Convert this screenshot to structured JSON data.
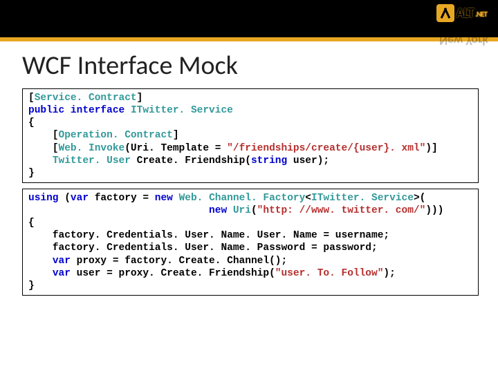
{
  "brand": {
    "name_line1": "ALT",
    "name_line1_suffix": ".NET",
    "name_line2": "New York"
  },
  "slide": {
    "title": "WCF Interface Mock"
  },
  "code_block_1": [
    {
      "indent": 0,
      "tokens": [
        {
          "c": "pln",
          "t": "["
        },
        {
          "c": "typ",
          "t": "Service. Contract"
        },
        {
          "c": "pln",
          "t": "]"
        }
      ]
    },
    {
      "indent": 0,
      "tokens": [
        {
          "c": "kw",
          "t": "public interface "
        },
        {
          "c": "typ",
          "t": "ITwitter. Service"
        }
      ]
    },
    {
      "indent": 0,
      "tokens": [
        {
          "c": "pln",
          "t": "{"
        }
      ]
    },
    {
      "indent": 1,
      "tokens": [
        {
          "c": "pln",
          "t": "["
        },
        {
          "c": "typ",
          "t": "Operation. Contract"
        },
        {
          "c": "pln",
          "t": "]"
        }
      ]
    },
    {
      "indent": 1,
      "tokens": [
        {
          "c": "pln",
          "t": "["
        },
        {
          "c": "typ",
          "t": "Web. Invoke"
        },
        {
          "c": "pln",
          "t": "(Uri. Template = "
        },
        {
          "c": "str",
          "t": "\"/friendships/create/{user}. xml\""
        },
        {
          "c": "pln",
          "t": ")]"
        }
      ]
    },
    {
      "indent": 1,
      "tokens": [
        {
          "c": "typ",
          "t": "Twitter. User"
        },
        {
          "c": "pln",
          "t": " Create. Friendship("
        },
        {
          "c": "kw",
          "t": "string"
        },
        {
          "c": "pln",
          "t": " user);"
        }
      ]
    },
    {
      "indent": 0,
      "tokens": [
        {
          "c": "pln",
          "t": "}"
        }
      ]
    }
  ],
  "code_block_2": [
    {
      "indent": 0,
      "tokens": [
        {
          "c": "kw",
          "t": "using "
        },
        {
          "c": "pln",
          "t": "("
        },
        {
          "c": "kw",
          "t": "var"
        },
        {
          "c": "pln",
          "t": " factory = "
        },
        {
          "c": "kw",
          "t": "new "
        },
        {
          "c": "typ",
          "t": "Web. Channel. Factory"
        },
        {
          "c": "pln",
          "t": "<"
        },
        {
          "c": "typ",
          "t": "ITwitter. Service"
        },
        {
          "c": "pln",
          "t": ">("
        }
      ]
    },
    {
      "indent": 0,
      "tokens": [
        {
          "c": "pln",
          "t": "                              "
        },
        {
          "c": "kw",
          "t": "new "
        },
        {
          "c": "typ",
          "t": "Uri"
        },
        {
          "c": "pln",
          "t": "("
        },
        {
          "c": "str",
          "t": "\"http: //www. twitter. com/\""
        },
        {
          "c": "pln",
          "t": ")))"
        }
      ]
    },
    {
      "indent": 0,
      "tokens": [
        {
          "c": "pln",
          "t": "{"
        }
      ]
    },
    {
      "indent": 1,
      "tokens": [
        {
          "c": "pln",
          "t": "factory. Credentials. User. Name. User. Name = username;"
        }
      ]
    },
    {
      "indent": 1,
      "tokens": [
        {
          "c": "pln",
          "t": "factory. Credentials. User. Name. Password = password;"
        }
      ]
    },
    {
      "indent": 1,
      "tokens": [
        {
          "c": "kw",
          "t": "var"
        },
        {
          "c": "pln",
          "t": " proxy = factory. Create. Channel();"
        }
      ]
    },
    {
      "indent": 1,
      "tokens": [
        {
          "c": "kw",
          "t": "var"
        },
        {
          "c": "pln",
          "t": " user = proxy. Create. Friendship("
        },
        {
          "c": "str",
          "t": "\"user. To. Follow\""
        },
        {
          "c": "pln",
          "t": ");"
        }
      ]
    },
    {
      "indent": 0,
      "tokens": [
        {
          "c": "pln",
          "t": "}"
        }
      ]
    }
  ]
}
